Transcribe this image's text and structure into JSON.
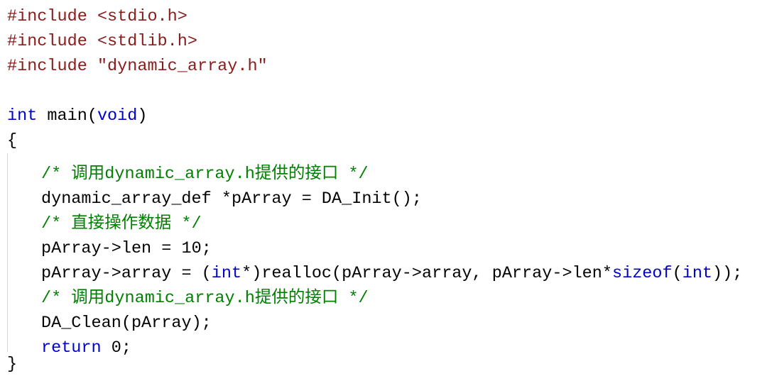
{
  "colors": {
    "preproc": "#8a1b1b",
    "keyword": "#0000cc",
    "comment": "#008000",
    "text": "#000000",
    "guide": "#d8d8d8",
    "background": "#ffffff"
  },
  "code": {
    "lines": [
      [
        {
          "t": "preproc",
          "v": "#include"
        },
        {
          "t": "punct",
          "v": " "
        },
        {
          "t": "anglestr",
          "v": "<stdio.h>"
        }
      ],
      [
        {
          "t": "preproc",
          "v": "#include"
        },
        {
          "t": "punct",
          "v": " "
        },
        {
          "t": "anglestr",
          "v": "<stdlib.h>"
        }
      ],
      [
        {
          "t": "preproc",
          "v": "#include"
        },
        {
          "t": "punct",
          "v": " "
        },
        {
          "t": "string",
          "v": "\"dynamic_array.h\""
        }
      ],
      [],
      [
        {
          "t": "type",
          "v": "int"
        },
        {
          "t": "punct",
          "v": " "
        },
        {
          "t": "ident",
          "v": "main"
        },
        {
          "t": "punct",
          "v": "("
        },
        {
          "t": "keyword",
          "v": "void"
        },
        {
          "t": "punct",
          "v": ")"
        }
      ],
      [
        {
          "t": "punct",
          "v": "{"
        }
      ],
      [
        {
          "t": "indent",
          "v": ""
        },
        {
          "t": "comment",
          "v": "/* 调用dynamic_array.h提供的接口 */"
        }
      ],
      [
        {
          "t": "indent",
          "v": ""
        },
        {
          "t": "ident",
          "v": "dynamic_array_def"
        },
        {
          "t": "punct",
          "v": " *"
        },
        {
          "t": "ident",
          "v": "pArray"
        },
        {
          "t": "punct",
          "v": " = "
        },
        {
          "t": "ident",
          "v": "DA_Init"
        },
        {
          "t": "punct",
          "v": "();"
        }
      ],
      [
        {
          "t": "indent",
          "v": ""
        },
        {
          "t": "comment",
          "v": "/* 直接操作数据 */"
        }
      ],
      [
        {
          "t": "indent",
          "v": ""
        },
        {
          "t": "ident",
          "v": "pArray"
        },
        {
          "t": "punct",
          "v": "->"
        },
        {
          "t": "ident",
          "v": "len"
        },
        {
          "t": "punct",
          "v": " = "
        },
        {
          "t": "number",
          "v": "10"
        },
        {
          "t": "punct",
          "v": ";"
        }
      ],
      [
        {
          "t": "indent",
          "v": ""
        },
        {
          "t": "ident",
          "v": "pArray"
        },
        {
          "t": "punct",
          "v": "->"
        },
        {
          "t": "ident",
          "v": "array"
        },
        {
          "t": "punct",
          "v": " = ("
        },
        {
          "t": "type",
          "v": "int"
        },
        {
          "t": "punct",
          "v": "*)"
        },
        {
          "t": "ident",
          "v": "realloc"
        },
        {
          "t": "punct",
          "v": "("
        },
        {
          "t": "ident",
          "v": "pArray"
        },
        {
          "t": "punct",
          "v": "->"
        },
        {
          "t": "ident",
          "v": "array"
        },
        {
          "t": "punct",
          "v": ", "
        },
        {
          "t": "ident",
          "v": "pArray"
        },
        {
          "t": "punct",
          "v": "->"
        },
        {
          "t": "ident",
          "v": "len"
        },
        {
          "t": "punct",
          "v": "*"
        },
        {
          "t": "keyword",
          "v": "sizeof"
        },
        {
          "t": "punct",
          "v": "("
        },
        {
          "t": "type",
          "v": "int"
        },
        {
          "t": "punct",
          "v": "));"
        }
      ],
      [
        {
          "t": "indent",
          "v": ""
        },
        {
          "t": "comment",
          "v": "/* 调用dynamic_array.h提供的接口 */"
        }
      ],
      [
        {
          "t": "indent",
          "v": ""
        },
        {
          "t": "ident",
          "v": "DA_Clean"
        },
        {
          "t": "punct",
          "v": "("
        },
        {
          "t": "ident",
          "v": "pArray"
        },
        {
          "t": "punct",
          "v": ");"
        }
      ],
      [
        {
          "t": "indent",
          "v": ""
        },
        {
          "t": "keyword",
          "v": "return"
        },
        {
          "t": "punct",
          "v": " "
        },
        {
          "t": "number",
          "v": "0"
        },
        {
          "t": "punct",
          "v": ";"
        }
      ],
      [
        {
          "t": "punct",
          "v": "}"
        }
      ]
    ]
  }
}
